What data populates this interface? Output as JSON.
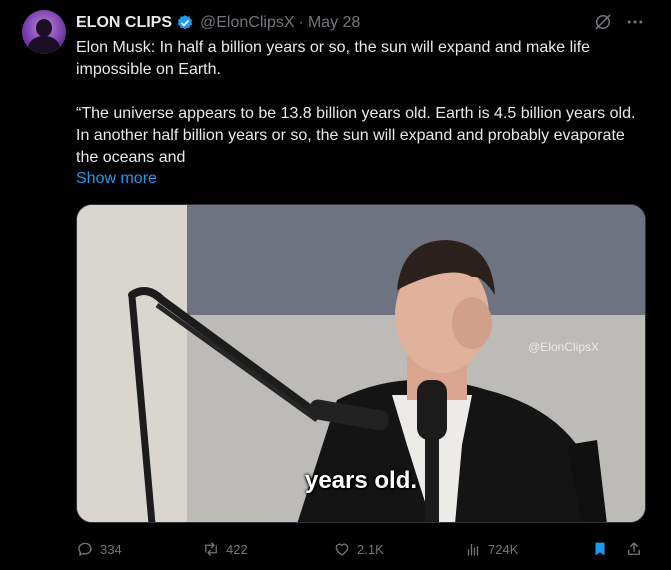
{
  "author": {
    "name": "ELON CLIPS",
    "handle": "@ElonClipsX",
    "separator": "·",
    "date": "May 28"
  },
  "tweet": {
    "paragraph1": "Elon Musk: In half a billion years or so, the sun will expand and make life impossible on Earth.",
    "paragraph2": "“The universe appears to be 13.8 billion years old. Earth is 4.5 billion years old. In another half billion years or so, the sun will expand and probably evaporate the oceans and",
    "show_more": "Show more"
  },
  "media": {
    "watermark": "@ElonClipsX",
    "caption": "years old."
  },
  "actions": {
    "replies": "334",
    "reposts": "422",
    "likes": "2.1K",
    "views": "724K"
  },
  "colors": {
    "background": "#000000",
    "accent": "#1d9bf0",
    "muted": "#71767b"
  }
}
